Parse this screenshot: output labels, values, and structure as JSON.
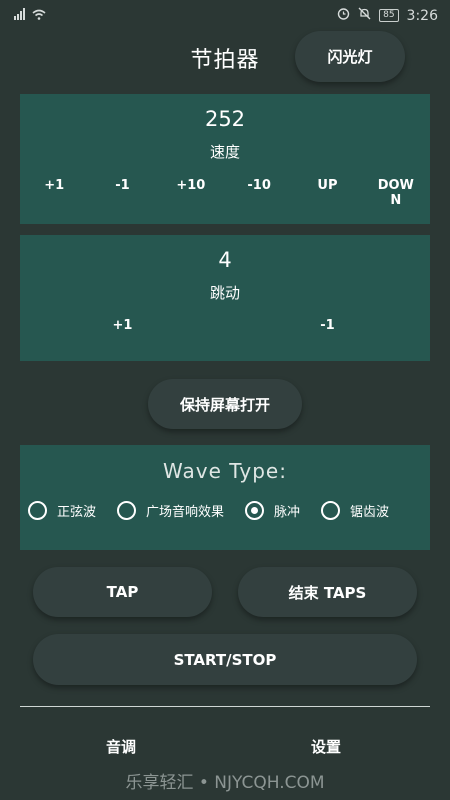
{
  "status": {
    "battery": "85",
    "time": "3:26"
  },
  "header": {
    "title": "节拍器",
    "flash_label": "闪光灯"
  },
  "tempo": {
    "value": "252",
    "label": "速度",
    "buttons": [
      "+1",
      "-1",
      "+10",
      "-10",
      "UP",
      "DOW\nN"
    ]
  },
  "beat": {
    "value": "4",
    "label": "跳动",
    "buttons": [
      "+1",
      "-1"
    ]
  },
  "keep_screen_label": "保持屏幕打开",
  "wave": {
    "title": "Wave Type:",
    "options": [
      "正弦波",
      "广场音响效果",
      "脉冲",
      "锯齿波"
    ],
    "selected_index": 2
  },
  "actions": {
    "tap": "TAP",
    "end_taps": "结束 TAPS",
    "start_stop": "START/STOP"
  },
  "bottom_nav": {
    "tone": "音调",
    "settings": "设置"
  },
  "watermark": "乐享轻汇 • NJYCQH.COM"
}
